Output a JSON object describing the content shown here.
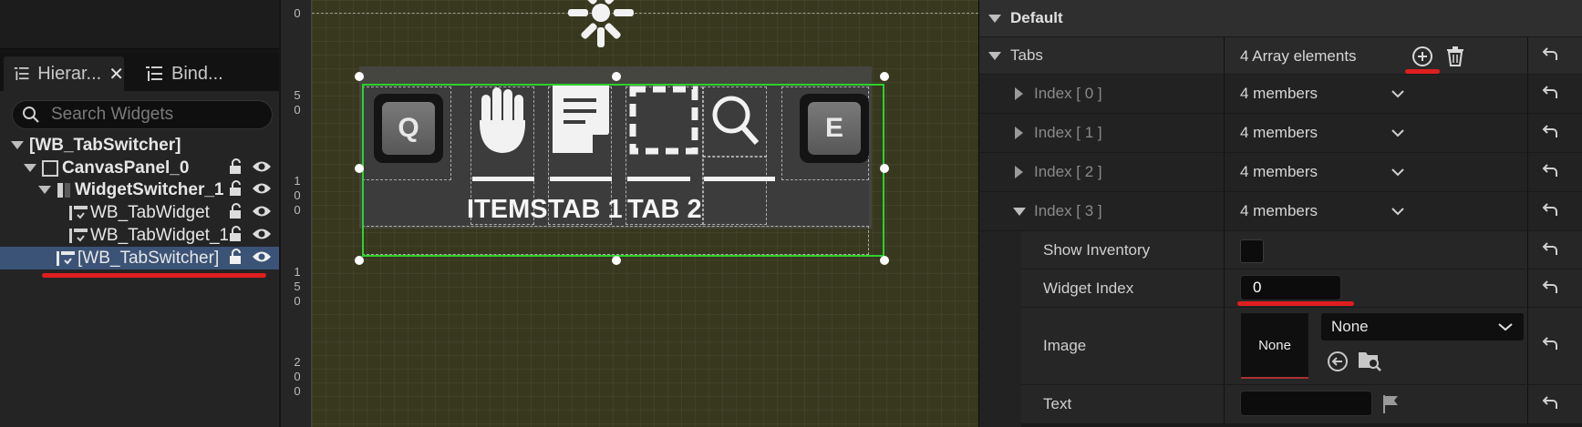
{
  "hierarchy": {
    "tabs": [
      {
        "label": "Hierar...",
        "icon": "list-tree-icon"
      },
      {
        "label": "Bind...",
        "icon": "list-icon"
      }
    ],
    "search": {
      "placeholder": "Search Widgets"
    },
    "tree": [
      {
        "label": "[WB_TabSwitcher]"
      },
      {
        "label": "CanvasPanel_0"
      },
      {
        "label": "WidgetSwitcher_1"
      },
      {
        "label": "WB_TabWidget"
      },
      {
        "label": "WB_TabWidget_1"
      },
      {
        "label": "[WB_TabSwitcher]"
      }
    ]
  },
  "designer": {
    "ruler": [
      "0",
      "5",
      "0",
      "1",
      "0",
      "0",
      "1",
      "5",
      "0",
      "2",
      "0",
      "0"
    ],
    "keys": {
      "left": "Q",
      "right": "E"
    },
    "tab_labels": [
      "ITEMS",
      "TAB 1",
      "TAB 2"
    ],
    "colors": {
      "selection": "#2ed12e",
      "canvas": "#38381f"
    }
  },
  "details": {
    "section": "Default",
    "tabs": {
      "name": "Tabs",
      "value": "4 Array elements"
    },
    "indices": [
      {
        "name": "Index [ 0 ]",
        "value": "4 members"
      },
      {
        "name": "Index [ 1 ]",
        "value": "4 members"
      },
      {
        "name": "Index [ 2 ]",
        "value": "4 members"
      },
      {
        "name": "Index [ 3 ]",
        "value": "4 members"
      }
    ],
    "show_inventory": {
      "name": "Show Inventory",
      "checked": false
    },
    "widget_index": {
      "name": "Widget Index",
      "value": "0"
    },
    "image": {
      "name": "Image",
      "thumb": "None",
      "dropdown": "None"
    },
    "text": {
      "name": "Text",
      "value": ""
    },
    "colors": {
      "annotation": "#e01e1e"
    }
  }
}
